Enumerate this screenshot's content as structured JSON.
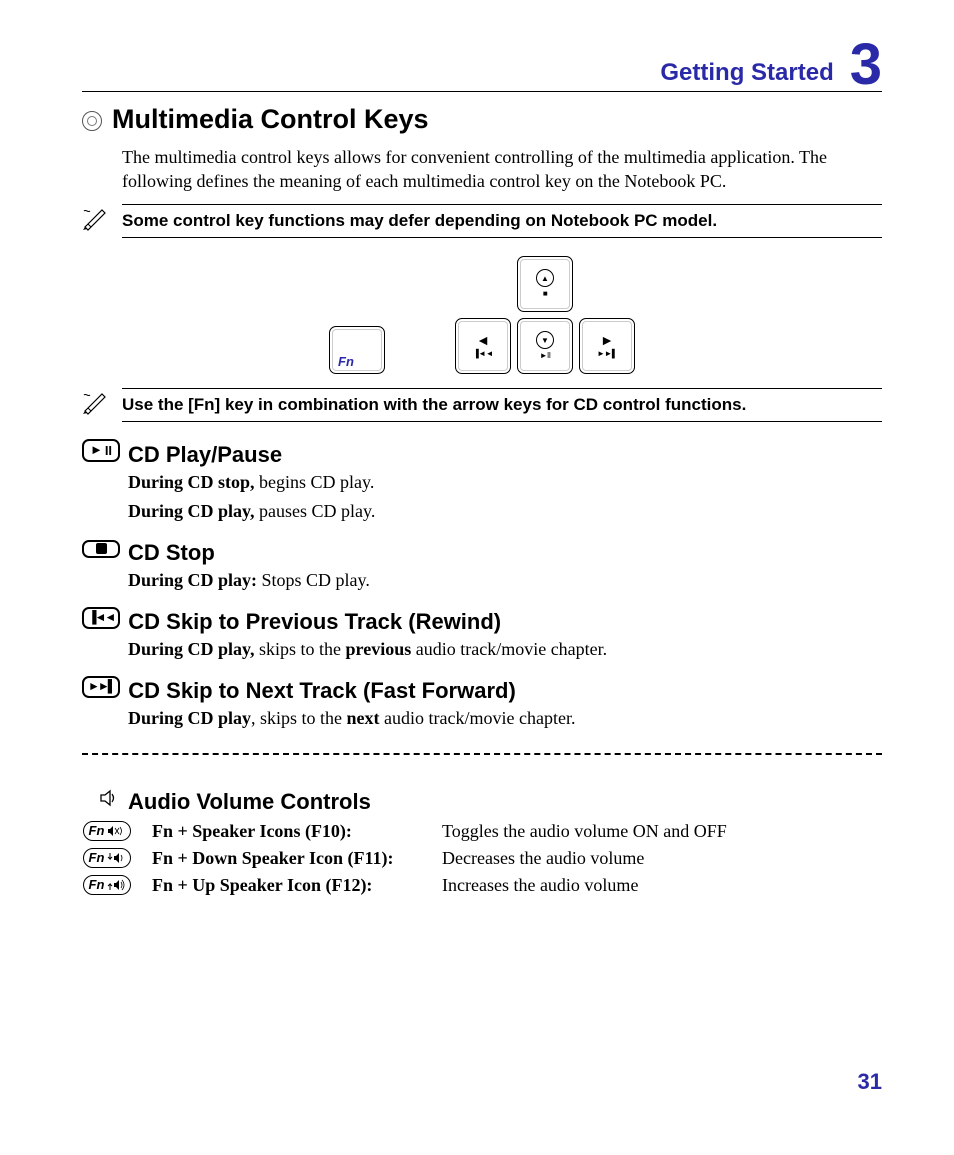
{
  "header": {
    "section": "Getting Started",
    "chapter": "3"
  },
  "title": "Multimedia Control Keys",
  "intro": "The multimedia control keys allows for convenient controlling of the multimedia application. The following defines the meaning of each multimedia control key on the Notebook PC.",
  "note1": "Some control key functions may defer depending on Notebook PC model.",
  "note2": "Use the [Fn] key in combination with the arrow keys for CD control functions.",
  "keys": {
    "fn": "Fn",
    "up_mini": "■",
    "left_mini": "▐◄◄",
    "down_mini": "►II",
    "right_mini": "►►▌"
  },
  "items": [
    {
      "title": "CD Play/Pause",
      "lines": [
        {
          "b": "During CD stop,",
          "t": " begins CD play."
        },
        {
          "b": "During CD play,",
          "t": " pauses CD play."
        }
      ]
    },
    {
      "title": "CD Stop",
      "lines": [
        {
          "b": "During CD play:",
          "t": " Stops CD play."
        }
      ]
    },
    {
      "title": "CD Skip to Previous Track (Rewind)",
      "lines": [
        {
          "b": "During CD play,",
          "t": " skips to the ",
          "b2": "previous",
          "t2": " audio track/movie chapter."
        }
      ]
    },
    {
      "title": "CD Skip to Next Track (Fast Forward)",
      "lines": [
        {
          "b": "During CD play",
          "t": ", skips to the ",
          "b2": "next",
          "t2": " audio track/movie chapter."
        }
      ]
    }
  ],
  "audio": {
    "title": "Audio Volume Controls",
    "rows": [
      {
        "label": "Fn + Speaker Icons (F10):",
        "desc": "Toggles the audio volume ON and OFF"
      },
      {
        "label": "Fn + Down Speaker Icon (F11):",
        "desc": "Decreases the audio volume"
      },
      {
        "label": "Fn + Up Speaker Icon (F12):",
        "desc": "Increases the audio volume"
      }
    ],
    "fn": "Fn"
  },
  "page": "31"
}
